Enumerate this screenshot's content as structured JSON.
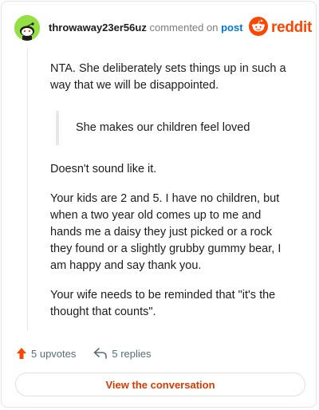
{
  "header": {
    "username": "throwaway23er56uz",
    "action_text": "commented on",
    "post_link": "post",
    "logo_text": "reddit"
  },
  "comment": {
    "paragraph_1": "NTA. She deliberately sets things up in such a way that we will be disappointed.",
    "quote": "She makes our children feel loved",
    "paragraph_2": "Doesn't sound like it.",
    "paragraph_3": "Your kids are 2 and 5. I have no children, but when a two year old comes up to me and hands me a daisy they just picked or a rock they found or a slightly grubby gummy bear, I am happy and say thank you.",
    "paragraph_4": "Your wife needs to be reminded that \"it's the thought that counts\"."
  },
  "footer": {
    "upvotes_label": "5 upvotes",
    "replies_label": "5 replies",
    "conversation_button": "View the conversation"
  },
  "colors": {
    "brand": "#ff4500",
    "link": "#0079d3",
    "avatar": "#94e044"
  },
  "icons": {
    "avatar": "snoo-avatar-icon",
    "logo": "reddit-logo-icon",
    "upvote": "upvote-arrow-icon",
    "reply": "reply-arrow-icon"
  }
}
